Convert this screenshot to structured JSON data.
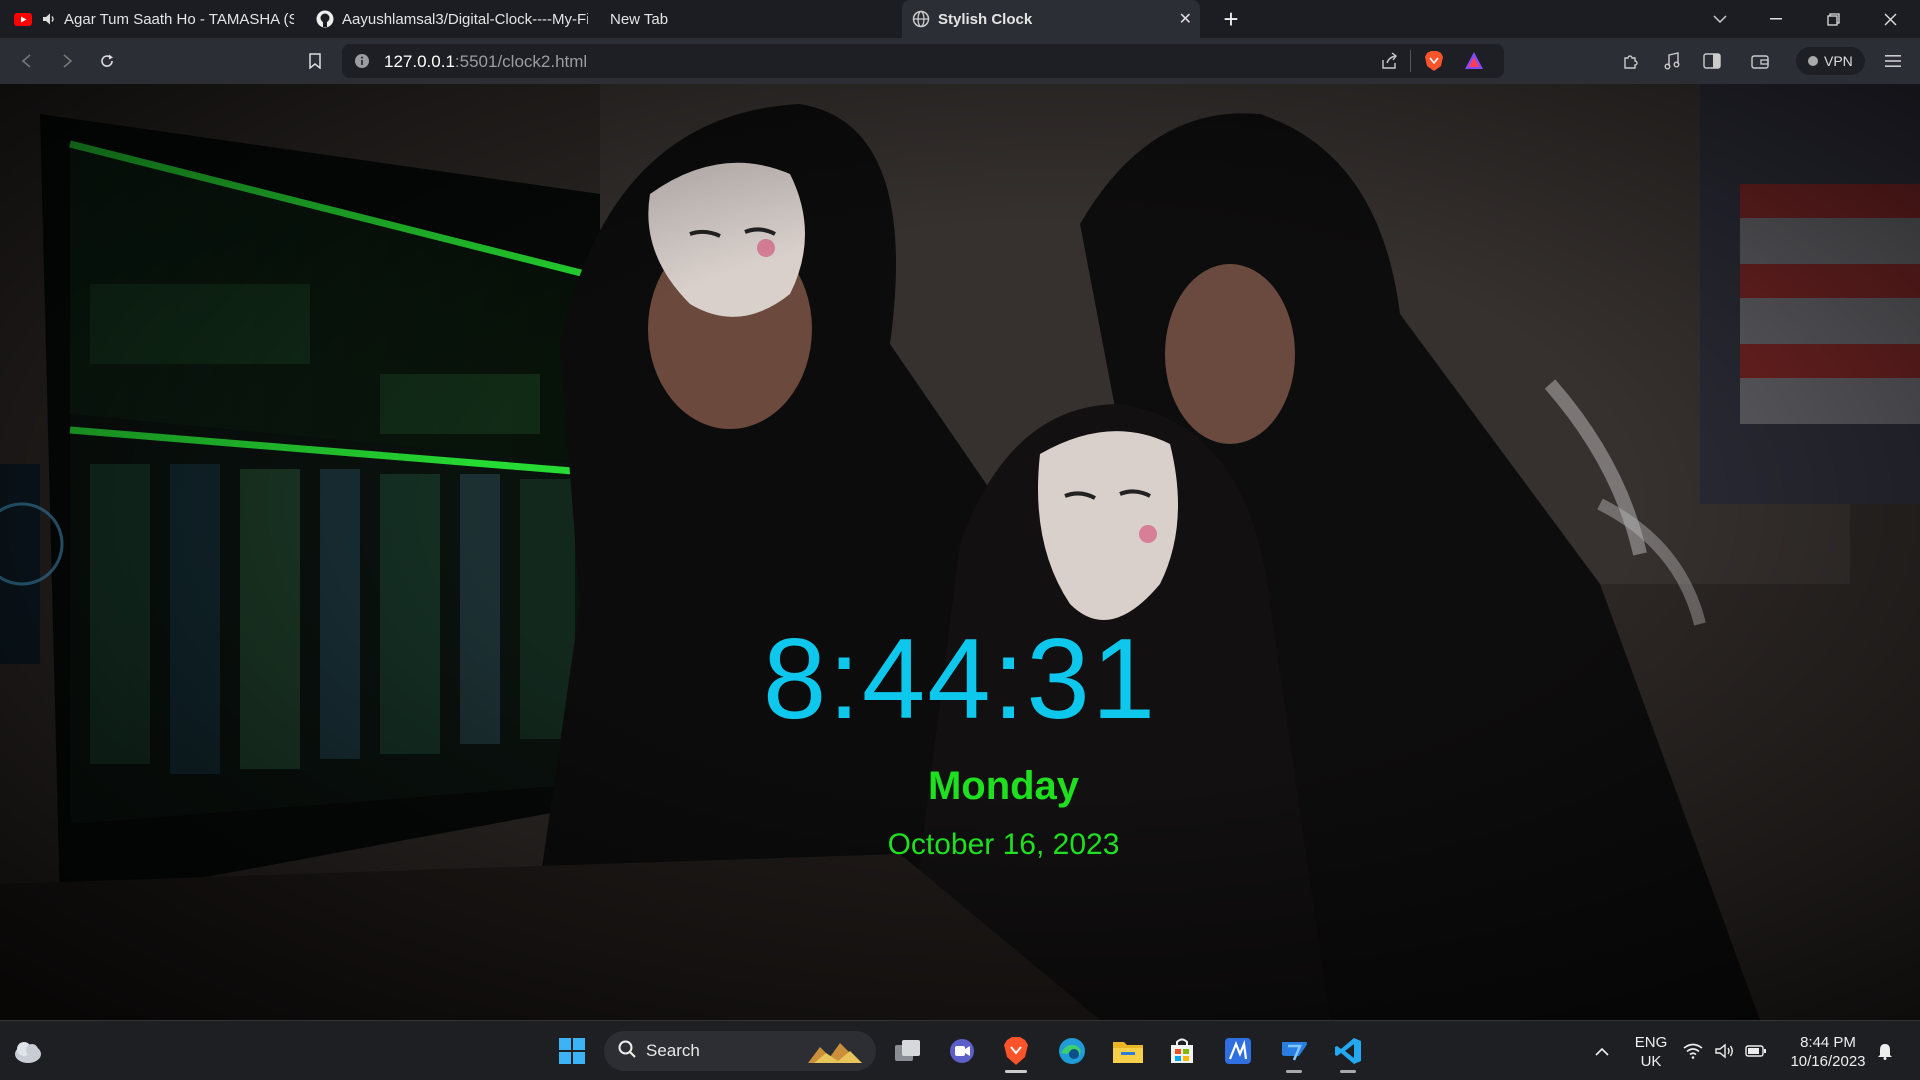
{
  "browser": {
    "tabs": [
      {
        "title": "Agar Tum Saath Ho - TAMASHA (S",
        "icon": "youtube-icon",
        "muted_icon": "speaker-icon"
      },
      {
        "title": "Aayushlamsal3/Digital-Clock----My-Fi",
        "icon": "github-icon"
      },
      {
        "title": "New Tab",
        "icon": ""
      },
      {
        "title": "Stylish Clock",
        "icon": "globe-icon",
        "active": true
      }
    ],
    "address": {
      "host": "127.0.0.1",
      "rest": ":5501/clock2.html"
    },
    "vpn_label": "VPN"
  },
  "clock": {
    "time": "8:44:31",
    "day": "Monday",
    "date": "October 16, 2023",
    "colors": {
      "time": "#0ec7ed",
      "day": "#1ee01e",
      "date": "#1ee01e"
    }
  },
  "taskbar": {
    "search_label": "Search",
    "language": {
      "line1": "ENG",
      "line2": "UK"
    },
    "clock": {
      "time": "8:44 PM",
      "date": "10/16/2023"
    }
  }
}
